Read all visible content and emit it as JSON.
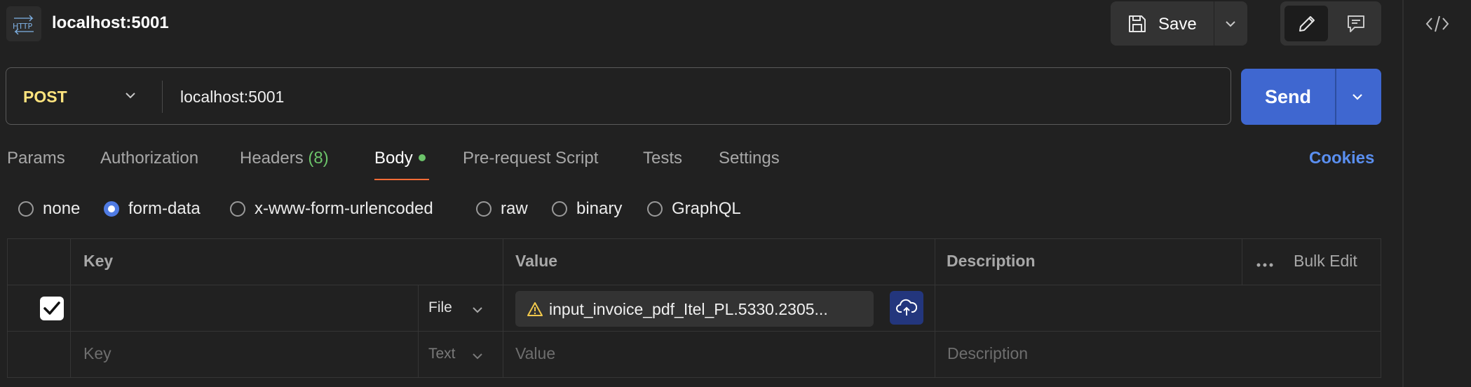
{
  "header": {
    "title": "localhost:5001",
    "save_label": "Save"
  },
  "request": {
    "method": "POST",
    "url": "localhost:5001",
    "send_label": "Send"
  },
  "tabs": [
    {
      "label": "Params"
    },
    {
      "label": "Authorization"
    },
    {
      "label": "Headers",
      "count": "(8)"
    },
    {
      "label": "Body"
    },
    {
      "label": "Pre-request Script"
    },
    {
      "label": "Tests"
    },
    {
      "label": "Settings"
    }
  ],
  "cookies_label": "Cookies",
  "body_types": [
    {
      "label": "none",
      "checked": false
    },
    {
      "label": "form-data",
      "checked": true
    },
    {
      "label": "x-www-form-urlencoded",
      "checked": false
    },
    {
      "label": "raw",
      "checked": false
    },
    {
      "label": "binary",
      "checked": false
    },
    {
      "label": "GraphQL",
      "checked": false
    }
  ],
  "table": {
    "headers": {
      "key": "Key",
      "value": "Value",
      "description": "Description",
      "bulk_edit": "Bulk Edit"
    },
    "rows": [
      {
        "checked": true,
        "key": "",
        "type": "File",
        "value": "input_invoice_pdf_Itel_PL.5330.2305...",
        "description": ""
      },
      {
        "checked": false,
        "key_placeholder": "Key",
        "type": "Text",
        "value_placeholder": "Value",
        "description_placeholder": "Description"
      }
    ]
  },
  "colors": {
    "accent": "#3f67d0",
    "method_post": "#ffe47e",
    "active_tab_underline": "#ff6c37",
    "count_green": "#6cc36a",
    "link_blue": "#5a8ff0"
  }
}
